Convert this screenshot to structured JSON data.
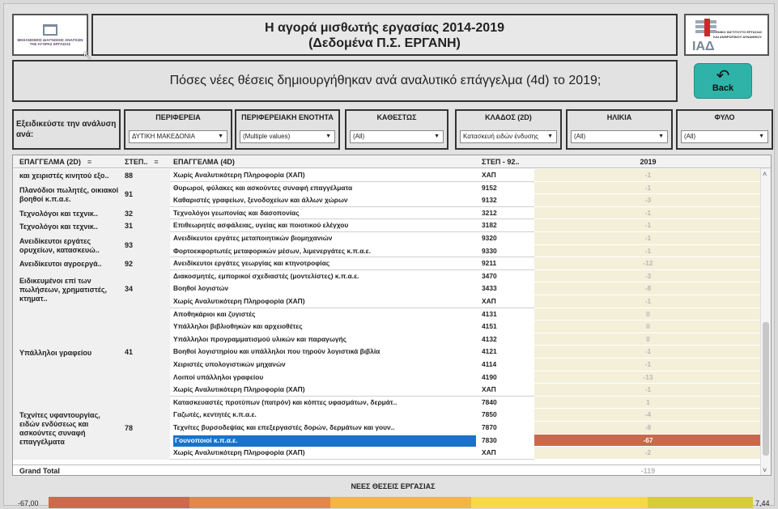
{
  "logo": {
    "text": "ΜΗΧΑΝΙΣΜΟΣ ΔΙΑΓΝΩΣΗΣ ΑΝΑΓΚΩΝ ΤΗΣ ΑΓΟΡΑΣ ΕΡΓΑΣΙΑΣ"
  },
  "header": {
    "title_line1": "Η αγορά μισθωτής εργασίας 2014-2019",
    "title_line2": "(Δεδομένα Π.Σ. ΕΡΓΑΝΗ)"
  },
  "brand": {
    "letters": "ΙΑΔ",
    "text": "ΕΘΝΙΚΟ ΙΝΣΤΙΤΟΥΤΟ ΕΡΓΑΣΙΑΣ ΚΑΙ ΑΝΘΡΩΠΙΝΟΥ ΔΥΝΑΜΙΚΟΥ"
  },
  "question": "Πόσες νέες θέσεις δημιουργήθηκαν ανά αναλυτικό επάγγελμα (4d) το 2019;",
  "back_button": {
    "label": "Back",
    "icon": "back-arrow-icon"
  },
  "filters": {
    "intro": "Εξειδικεύστε την ανάλυση ανά:",
    "items": [
      {
        "label": "ΠΕΡΙΦΕΡΕΙΑ",
        "value": "ΔΥΤΙΚΗ ΜΑΚΕΔΟΝΙΑ"
      },
      {
        "label": "ΠΕΡΙΦΕΡΕΙΑΚΗ ΕΝΟΤΗΤΑ",
        "value": "(Multiple values)"
      },
      {
        "label": "ΚΑΘΕΣΤΩΣ",
        "value": "(All)"
      },
      {
        "label": "ΚΛΑΔΟΣ (2D)",
        "value": "Κατασκευή ειδών ένδυσης"
      },
      {
        "label": "ΗΛΙΚΙΑ",
        "value": "(All)"
      },
      {
        "label": "ΦΥΛΟ",
        "value": "(All)"
      }
    ]
  },
  "table": {
    "headers": {
      "occ2d": "ΕΠΑΓΓΕΛΜΑ (2D)",
      "step": "ΣΤΕΠ..",
      "occ4d": "ΕΠΑΓΓΕΛΜΑ (4D)",
      "step92": "ΣΤΕΠ - 92..",
      "year": "2019"
    },
    "groups": [
      {
        "name": "και χειριστές κινητού εξο..",
        "code": "88",
        "rows": [
          {
            "occ": "Χωρίς Αναλυτικότερη Πληροφορία (ΧΑΠ)",
            "code": "ΧΑΠ",
            "value": "-1"
          }
        ]
      },
      {
        "name": "Πλανόδιοι πωλητές, οικιακοί βοηθοί κ.π.α.ε.",
        "code": "91",
        "rows": [
          {
            "occ": "Θυρωροί, φύλακες και ασκούντες συναφή επαγγέλματα",
            "code": "9152",
            "value": "-1"
          },
          {
            "occ": "Καθαριστές γραφείων, ξενοδοχείων και άλλων χώρων",
            "code": "9132",
            "value": "-3"
          }
        ]
      },
      {
        "name": "Τεχνολόγοι και τεχνικ..",
        "code": "32",
        "rows": [
          {
            "occ": "Τεχνολόγοι γεωπονίας και δασοπονίας",
            "code": "3212",
            "value": "-1"
          }
        ]
      },
      {
        "name": "Τεχνολόγοι και τεχνικ..",
        "code": "31",
        "rows": [
          {
            "occ": "Επιθεωρητές ασφάλειας, υγείας και ποιοτικού ελέγχου",
            "code": "3182",
            "value": "-1"
          }
        ]
      },
      {
        "name": "Ανειδίκευτοι εργάτες ορυχείων, κατασκευώ..",
        "code": "93",
        "rows": [
          {
            "occ": "Ανειδίκευτοι εργάτες μεταποιητικών βιομηχανιών",
            "code": "9320",
            "value": "-1"
          },
          {
            "occ": "Φορτοεκφορτωτές μεταφορικών μέσων, λιμενεργάτες κ.π.α.ε.",
            "code": "9330",
            "value": "-1"
          }
        ]
      },
      {
        "name": "Ανειδίκευτοι αγροεργά..",
        "code": "92",
        "rows": [
          {
            "occ": "Ανειδίκευτοι εργάτες γεωργίας και κτηνοτροφίας",
            "code": "9211",
            "value": "-12"
          }
        ]
      },
      {
        "name": "Ειδικευμένοι επί των πωλήσεων, χρηματιστές, κτηματ..",
        "code": "34",
        "rows": [
          {
            "occ": "Διακοσμητές, εμπορικοί σχεδιαστές (μοντελίστες) κ.π.α.ε.",
            "code": "3470",
            "value": "-3"
          },
          {
            "occ": "Βοηθοί λογιστών",
            "code": "3433",
            "value": "-8"
          },
          {
            "occ": "Χωρίς Αναλυτικότερη Πληροφορία (ΧΑΠ)",
            "code": "ΧΑΠ",
            "value": "-1"
          }
        ]
      },
      {
        "name": "Υπάλληλοι γραφείου",
        "code": "41",
        "rows": [
          {
            "occ": "Αποθηκάριοι και ζυγιστές",
            "code": "4131",
            "value": "0"
          },
          {
            "occ": "Υπάλληλοι βιβλιοθηκών και αρχειοθέτες",
            "code": "4151",
            "value": "0"
          },
          {
            "occ": "Υπάλληλοι προγραμματισμού υλικών και παραγωγής",
            "code": "4132",
            "value": "0"
          },
          {
            "occ": "Βοηθοί λογιστηρίου και υπάλληλοι που τηρούν λογιστικά βιβλία",
            "code": "4121",
            "value": "-1"
          },
          {
            "occ": "Χειριστές υπολογιστικών μηχανών",
            "code": "4114",
            "value": "-1"
          },
          {
            "occ": "Λοιποί υπάλληλοι γραφείου",
            "code": "4190",
            "value": "-13"
          },
          {
            "occ": "Χωρίς Αναλυτικότερη Πληροφορία (ΧΑΠ)",
            "code": "ΧΑΠ",
            "value": "-1"
          }
        ]
      },
      {
        "name": "Τεχνίτες υφαντουργίας, ειδών ενδύσεως και ασκούντες συναφή επαγγέλματα",
        "code": "78",
        "rows": [
          {
            "occ": "Κατασκευαστές προτύπων (πατρόν) και κόπτες υφασμάτων, δερμάτ..",
            "code": "7840",
            "value": "1"
          },
          {
            "occ": "Γαζωτές, κεντητές κ.π.α.ε.",
            "code": "7850",
            "value": "-4"
          },
          {
            "occ": "Τεχνίτες βυρσοδεψίας και επεξεργαστές δορών, δερμάτων και γουν..",
            "code": "7870",
            "value": "-8"
          },
          {
            "occ": "Γουνοποιοί κ.π.α.ε.",
            "code": "7830",
            "value": "-67",
            "highlight": true
          },
          {
            "occ": "Χωρίς Αναλυτικότερη Πληροφορία (ΧΑΠ)",
            "code": "ΧΑΠ",
            "value": "-2"
          }
        ]
      }
    ],
    "grand_total_label": "Grand Total",
    "grand_total_value": "-119"
  },
  "legend": {
    "title": "ΝΕΕΣ ΘΕΣΕΙΣ ΕΡΓΑΣΙΑΣ",
    "min": "-67,00",
    "max": "7,44",
    "colors": [
      "#cc6a4e",
      "#e1884c",
      "#f4b446",
      "#f6d94a",
      "#d8cc3c"
    ]
  }
}
